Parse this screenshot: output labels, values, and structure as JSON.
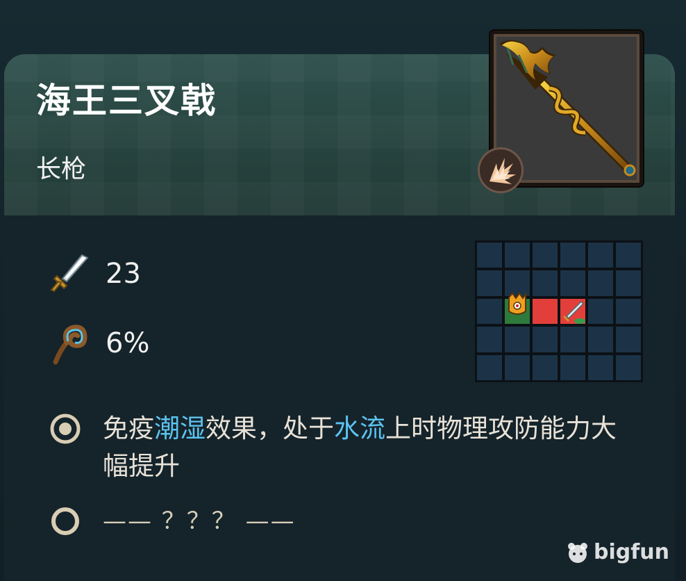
{
  "item": {
    "name": "海王三叉戟",
    "type": "长枪",
    "icon": "trident-icon",
    "badge_icon": "impact-burst-icon"
  },
  "stats": [
    {
      "icon": "sword-icon",
      "value": "23"
    },
    {
      "icon": "staff-icon",
      "value": "6%"
    }
  ],
  "range_grid": {
    "rows": 5,
    "cols": 6,
    "self": {
      "row": 2,
      "col": 1
    },
    "hits": [
      {
        "row": 2,
        "col": 2
      },
      {
        "row": 2,
        "col": 3
      }
    ]
  },
  "effects": [
    {
      "bullet_icon": "filled-circle-icon",
      "parts": [
        {
          "text": "免疫",
          "highlight": false
        },
        {
          "text": "潮湿",
          "highlight": true
        },
        {
          "text": "效果，处于",
          "highlight": false
        },
        {
          "text": "水流",
          "highlight": true
        },
        {
          "text": "上时物理攻防能力大幅提升",
          "highlight": false
        }
      ]
    },
    {
      "bullet_icon": "empty-circle-icon",
      "text": "—— ？？？ ——"
    }
  ],
  "watermark": {
    "text": "bigfun",
    "icon": "bigfun-logo-icon"
  },
  "colors": {
    "highlight": "#5cc3f0",
    "header": "#2e504d",
    "body": "#15232a",
    "hit": "#e33f3a",
    "self": "#2e7a3c"
  }
}
